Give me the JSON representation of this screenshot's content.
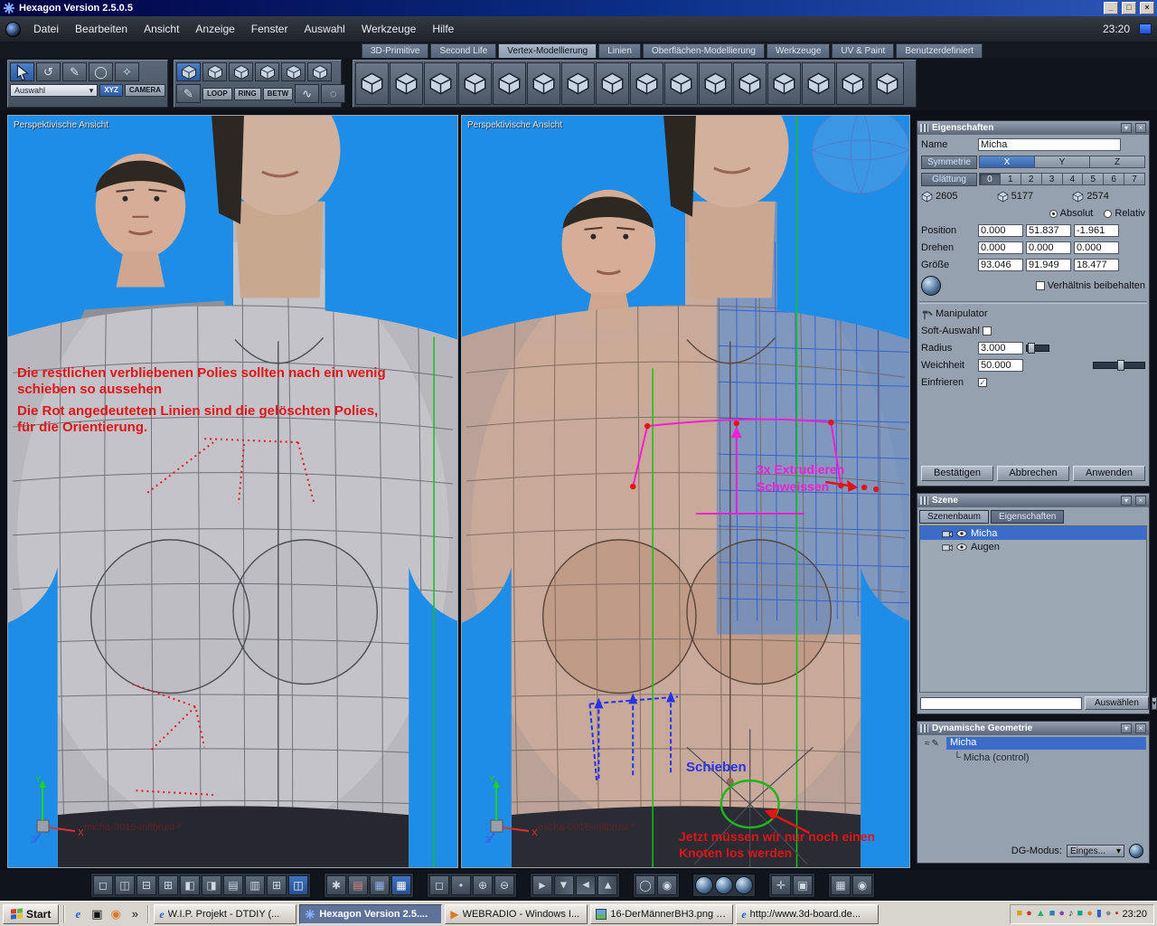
{
  "titlebar": {
    "title": "Hexagon Version 2.5.0.5",
    "buttons": {
      "minimize": "_",
      "maximize": "□",
      "close": "×"
    }
  },
  "menubar": {
    "items": [
      "Datei",
      "Bearbeiten",
      "Ansicht",
      "Anzeige",
      "Fenster",
      "Auswahl",
      "Werkzeuge",
      "Hilfe"
    ],
    "clock": "23:20"
  },
  "tabs": {
    "items": [
      "3D-Primitive",
      "Second Life",
      "Vertex-Modellierung",
      "Linien",
      "Oberflächen-Modellierung",
      "Werkzeuge",
      "UV & Paint",
      "Benutzerdefiniert"
    ]
  },
  "toolbar": {
    "selection_dropdown": "Auswahl",
    "xyz": "XYZ",
    "camera": "CAMERA",
    "loop": "LOOP",
    "ring": "RING",
    "betw": "BETW"
  },
  "viewports": {
    "left": {
      "title": "Perspektivische Ansicht",
      "note_line1": "Die restlichen verbliebenen Polies sollten nach ein wenig",
      "note_line2": "schieben so aussehen",
      "note_line3": "Die Rot angedeuteten Linien sind die gelöschten Polies,",
      "note_line4": "für die Orientierung.",
      "model_label": "micha-0016-mitbrust *",
      "axis": {
        "x": "X",
        "y": "Y",
        "z": "Z"
      }
    },
    "right": {
      "title": "Perspektivische Ansicht",
      "note_extrude": "3x Extrudieren",
      "note_weld": "Schweissen",
      "note_push": "Schieben",
      "note_knot1": "Jetzt müssen wir nur noch einen",
      "note_knot2": "Knoten los werden",
      "model_label": "micha-0016-mitbrust *",
      "axis": {
        "x": "X",
        "y": "Y",
        "z": "Z"
      }
    }
  },
  "properties": {
    "title": "Eigenschaften",
    "name_label": "Name",
    "name_value": "Micha",
    "symmetry_label": "Symmetrie",
    "sym_x": "X",
    "sym_y": "Y",
    "sym_z": "Z",
    "smoothing_label": "Glättung",
    "smoothing_levels": [
      "0",
      "1",
      "2",
      "3",
      "4",
      "5",
      "6",
      "7"
    ],
    "count_vertices": "2605",
    "count_edges": "5177",
    "count_faces": "2574",
    "absolute": "Absolut",
    "relative": "Relativ",
    "position_label": "Position",
    "position_x": "0.000",
    "position_y": "51.837",
    "position_z": "-1.961",
    "rotate_label": "Drehen",
    "rotate_x": "0.000",
    "rotate_y": "0.000",
    "rotate_z": "0.000",
    "size_label": "Größe",
    "size_x": "93.046",
    "size_y": "91.949",
    "size_z": "18.477",
    "keep_ratio": "Verhältnis beibehalten",
    "manipulator": "Manipulator",
    "soft_selection": "Soft-Auswahl",
    "radius_label": "Radius",
    "radius_value": "3.000",
    "softness_label": "Weichheit",
    "softness_value": "50.000",
    "freeze_label": "Einfrieren",
    "confirm": "Bestätigen",
    "cancel": "Abbrechen",
    "apply": "Anwenden"
  },
  "scene": {
    "title": "Szene",
    "tab_tree": "Szenenbaum",
    "tab_props": "Eigenschaften",
    "item1": "Micha",
    "item2": "Augen",
    "select_button": "Auswählen"
  },
  "dg": {
    "title": "Dynamische Geometrie",
    "item1": "Micha",
    "item2": "Micha (control)",
    "mode_label": "DG-Modus:",
    "mode_value": "Einges..."
  },
  "taskbar": {
    "start": "Start",
    "tasks": [
      {
        "label": "W.I.P. Projekt - DTDIY (..."
      },
      {
        "label": "Hexagon Version 2.5...."
      },
      {
        "label": "WEBRADIO - Windows I..."
      },
      {
        "label": "16-DerMännerBH3.png - ..."
      },
      {
        "label": "http://www.3d-board.de..."
      }
    ],
    "clock": "23:20"
  }
}
